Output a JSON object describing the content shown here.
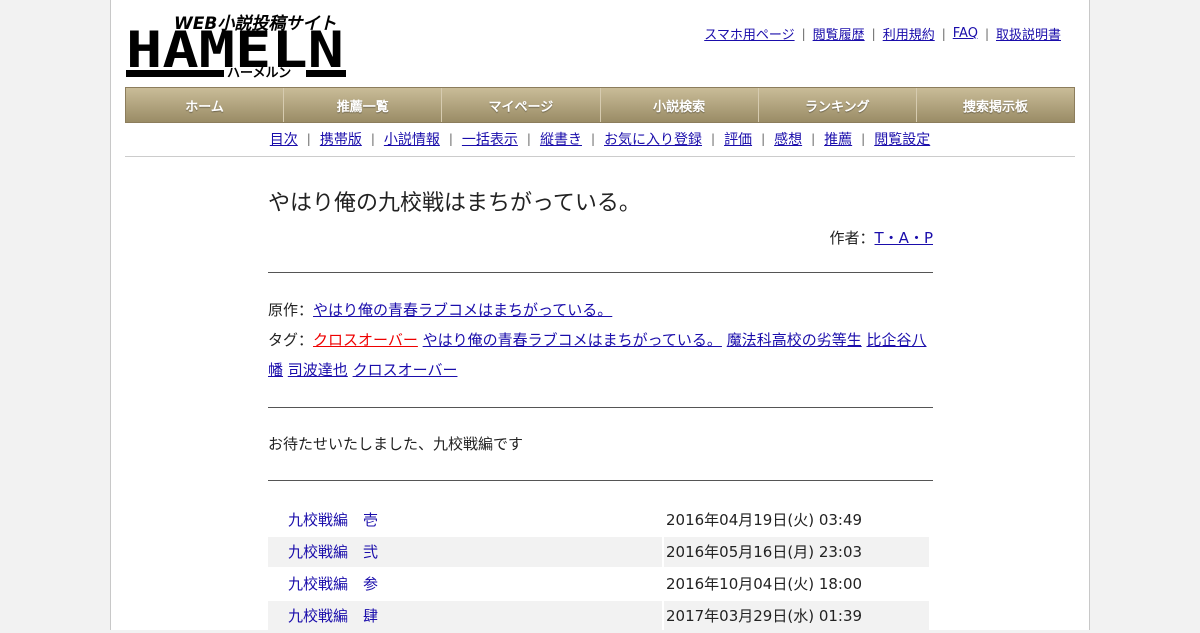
{
  "site": {
    "logo_main": "HAMELN",
    "logo_tagline": "WEB小説投稿サイト",
    "logo_kana": "ハーメルン"
  },
  "top_links": [
    "スマホ用ページ",
    "閲覧履歴",
    "利用規約",
    "FAQ",
    "取扱説明書"
  ],
  "nav": [
    "ホーム",
    "推薦一覧",
    "マイページ",
    "小説検索",
    "ランキング",
    "捜索掲示板"
  ],
  "subnav": [
    "目次",
    "携帯版",
    "小説情報",
    "一括表示",
    "縦書き",
    "お気に入り登録",
    "評価",
    "感想",
    "推薦",
    "閲覧設定"
  ],
  "novel": {
    "title": "やはり俺の九校戦はまちがっている。",
    "author_label": "作者：",
    "author": "T・A・P",
    "original_label": "原作：",
    "original": "やはり俺の青春ラブコメはまちがっている。",
    "tags_label": "タグ：",
    "tags": [
      "クロスオーバー",
      "やはり俺の青春ラブコメはまちがっている。",
      "魔法科高校の劣等生",
      "比企谷八幡",
      "司波達也",
      "クロスオーバー"
    ],
    "preface": "お待たせいたしました、九校戦編です"
  },
  "chapters": [
    {
      "title": "九校戦編　壱",
      "date": "2016年04月19日(火) 03:49"
    },
    {
      "title": "九校戦編　弐",
      "date": "2016年05月16日(月) 23:03"
    },
    {
      "title": "九校戦編　参",
      "date": "2016年10月04日(火) 18:00"
    },
    {
      "title": "九校戦編　肆",
      "date": "2017年03月29日(水) 01:39"
    }
  ],
  "colors": {
    "link": "#1a0dab",
    "tag_highlight": "#e00000",
    "nav_gradient_top": "#c9bc98",
    "nav_gradient_bottom": "#9a8c66"
  }
}
